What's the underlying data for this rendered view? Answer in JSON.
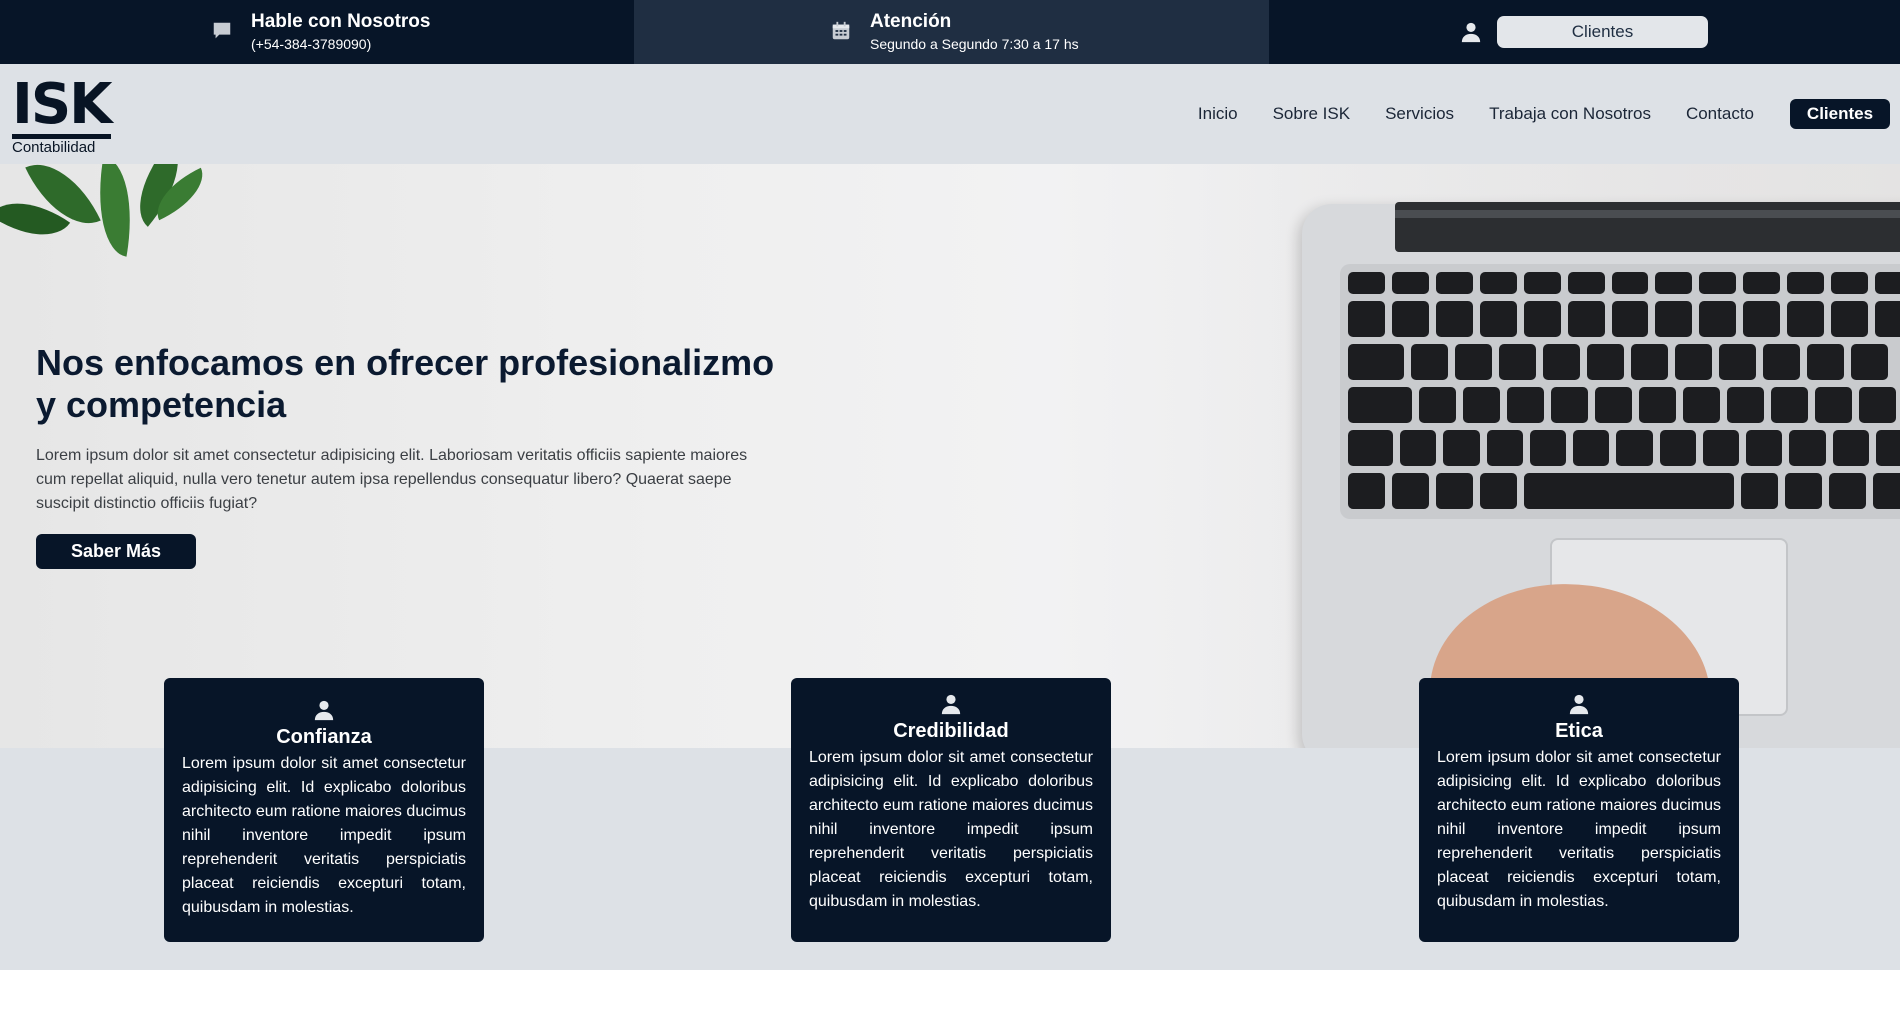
{
  "colors": {
    "navy": "#071528",
    "slate": "#1f2e42",
    "light_band": "#dde1e6"
  },
  "topbar": {
    "talk": {
      "icon": "chat-icon",
      "title": "Hable con Nosotros",
      "sub": "(+54-384-3789090)"
    },
    "hours": {
      "icon": "calendar-icon",
      "title": "Atención",
      "sub": "Segundo a Segundo 7:30 a 17 hs"
    },
    "user_icon": "user-icon",
    "clients_label": "Clientes"
  },
  "navbar": {
    "logo_mark": "ISK",
    "logo_tag": "Contabilidad",
    "links": [
      "Inicio",
      "Sobre ISK",
      "Servicios",
      "Trabaja con Nosotros",
      "Contacto"
    ],
    "clients_label": "Clientes"
  },
  "hero": {
    "title": "Nos enfocamos en ofrecer profesionalizmo y competencia",
    "text": "Lorem ipsum dolor sit amet consectetur adipisicing elit. Laboriosam veritatis officiis sapiente maiores cum repellat aliquid, nulla vero tenetur autem ipsa repellendus consequatur libero? Quaerat saepe suscipit distinctio officiis fugiat?",
    "button": "Saber Más"
  },
  "cards": [
    {
      "icon": "user-icon",
      "title": "Confianza",
      "text": "Lorem ipsum dolor sit amet consectetur adipisicing elit. Id explicabo doloribus architecto eum ratione maiores ducimus nihil inventore impedit ipsum reprehenderit veritatis perspiciatis placeat reiciendis excepturi totam, quibusdam in molestias."
    },
    {
      "icon": "user-icon",
      "title": "Credibilidad",
      "text": "Lorem ipsum dolor sit amet consectetur adipisicing elit. Id explicabo doloribus architecto eum ratione maiores ducimus nihil inventore impedit ipsum reprehenderit veritatis perspiciatis placeat reiciendis excepturi totam, quibusdam in molestias."
    },
    {
      "icon": "user-icon",
      "title": "Etica",
      "text": "Lorem ipsum dolor sit amet consectetur adipisicing elit. Id explicabo doloribus architecto eum ratione maiores ducimus nihil inventore impedit ipsum reprehenderit veritatis perspiciatis placeat reiciendis excepturi totam, quibusdam in molestias."
    }
  ]
}
